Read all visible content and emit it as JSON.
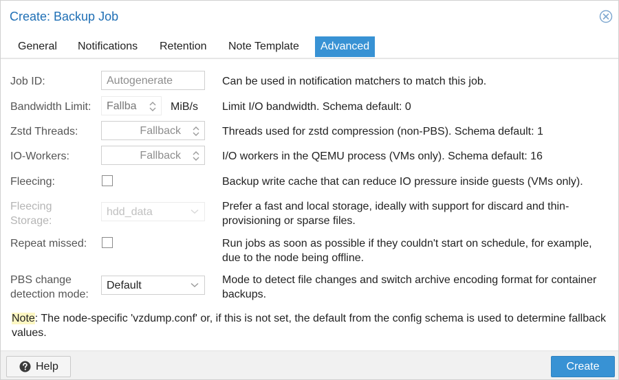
{
  "dialog": {
    "title": "Create: Backup Job",
    "close_icon": "close-circle-icon"
  },
  "tabs": [
    {
      "label": "General",
      "active": false
    },
    {
      "label": "Notifications",
      "active": false
    },
    {
      "label": "Retention",
      "active": false
    },
    {
      "label": "Note Template",
      "active": false
    },
    {
      "label": "Advanced",
      "active": true
    }
  ],
  "fields": {
    "job_id": {
      "label": "Job ID:",
      "placeholder": "Autogenerate",
      "description": "Can be used in notification matchers to match this job."
    },
    "bandwidth": {
      "label": "Bandwidth Limit:",
      "placeholder": "Fallba",
      "unit": "MiB/s",
      "description": "Limit I/O bandwidth. Schema default: 0"
    },
    "zstd": {
      "label": "Zstd Threads:",
      "placeholder": "Fallback",
      "description": "Threads used for zstd compression (non-PBS). Schema default: 1"
    },
    "io_workers": {
      "label": "IO-Workers:",
      "placeholder": "Fallback",
      "description": "I/O workers in the QEMU process (VMs only). Schema default: 16"
    },
    "fleecing": {
      "label": "Fleecing:",
      "checked": false,
      "description": "Backup write cache that can reduce IO pressure inside guests (VMs only)."
    },
    "fleecing_storage": {
      "label_line1": "Fleecing",
      "label_line2": "Storage:",
      "value": "hdd_data",
      "disabled": true,
      "description": "Prefer a fast and local storage, ideally with support for discard and thin-provisioning or sparse files."
    },
    "repeat_missed": {
      "label": "Repeat missed:",
      "checked": false,
      "description": "Run jobs as soon as possible if they couldn't start on schedule, for example, due to the node being offline."
    },
    "pbs_change": {
      "label_line1": "PBS change",
      "label_line2": "detection mode:",
      "value": "Default",
      "description": "Mode to detect file changes and switch archive encoding format for container backups."
    }
  },
  "note": {
    "prefix": "Note",
    "text": ": The node-specific 'vzdump.conf' or, if this is not set, the default from the config schema is used to determine fallback values."
  },
  "footer": {
    "help_label": "Help",
    "help_icon": "question-circle-icon",
    "create_label": "Create"
  },
  "colors": {
    "accent": "#3892d4",
    "title": "#1f6fb5"
  }
}
